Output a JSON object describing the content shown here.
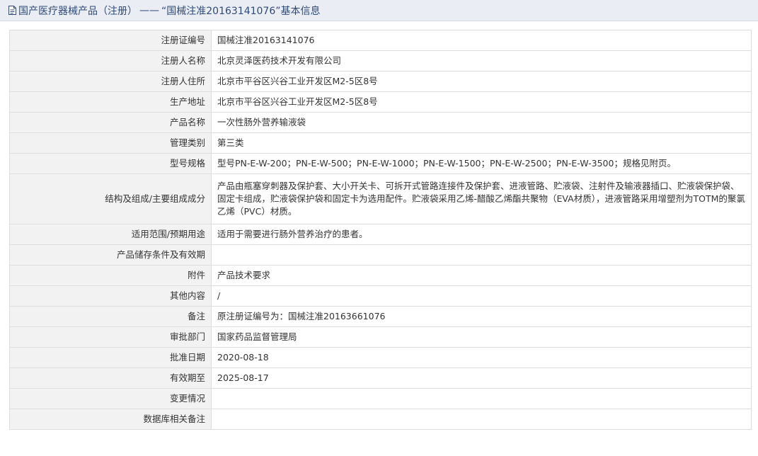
{
  "header": {
    "section": "国产医疗器械产品（注册）",
    "separator": "——",
    "record_title": "“国械注准20163141076”基本信息"
  },
  "rows": [
    {
      "label": "注册证编号",
      "value": "国械注准20163141076"
    },
    {
      "label": "注册人名称",
      "value": "北京灵泽医药技术开发有限公司"
    },
    {
      "label": "注册人住所",
      "value": "北京市平谷区兴谷工业开发区M2-5区8号"
    },
    {
      "label": "生产地址",
      "value": "北京市平谷区兴谷工业开发区M2-5区8号"
    },
    {
      "label": "产品名称",
      "value": "一次性肠外营养输液袋"
    },
    {
      "label": "管理类别",
      "value": "第三类"
    },
    {
      "label": "型号规格",
      "value": "型号PN-E-W-200；PN-E-W-500；PN-E-W-1000；PN-E-W-1500；PN-E-W-2500；PN-E-W-3500；规格见附页。"
    },
    {
      "label": "结构及组成/主要组成成分",
      "value": "产品由瓶塞穿刺器及保护套、大小开关卡、可拆开式管路连接件及保护套、进液管路、贮液袋、注射件及输液器插口、贮液袋保护袋、固定卡组成，贮液袋保护袋和固定卡为选用配件。贮液袋采用乙烯-醋酸乙烯酯共聚物（EVA材质），进液管路采用增塑剂为TOTM的聚氯乙烯（PVC）材质。"
    },
    {
      "label": "适用范围/预期用途",
      "value": "适用于需要进行肠外营养治疗的患者。"
    },
    {
      "label": "产品储存条件及有效期",
      "value": ""
    },
    {
      "label": "附件",
      "value": "产品技术要求"
    },
    {
      "label": "其他内容",
      "value": "/"
    },
    {
      "label": "备注",
      "value": "原注册证编号为：国械注准20163661076"
    },
    {
      "label": "审批部门",
      "value": "国家药品监督管理局"
    },
    {
      "label": "批准日期",
      "value": "2020-08-18"
    },
    {
      "label": "有效期至",
      "value": "2025-08-17"
    },
    {
      "label": "变更情况",
      "value": ""
    },
    {
      "label": "数据库相关备注",
      "value": ""
    }
  ]
}
